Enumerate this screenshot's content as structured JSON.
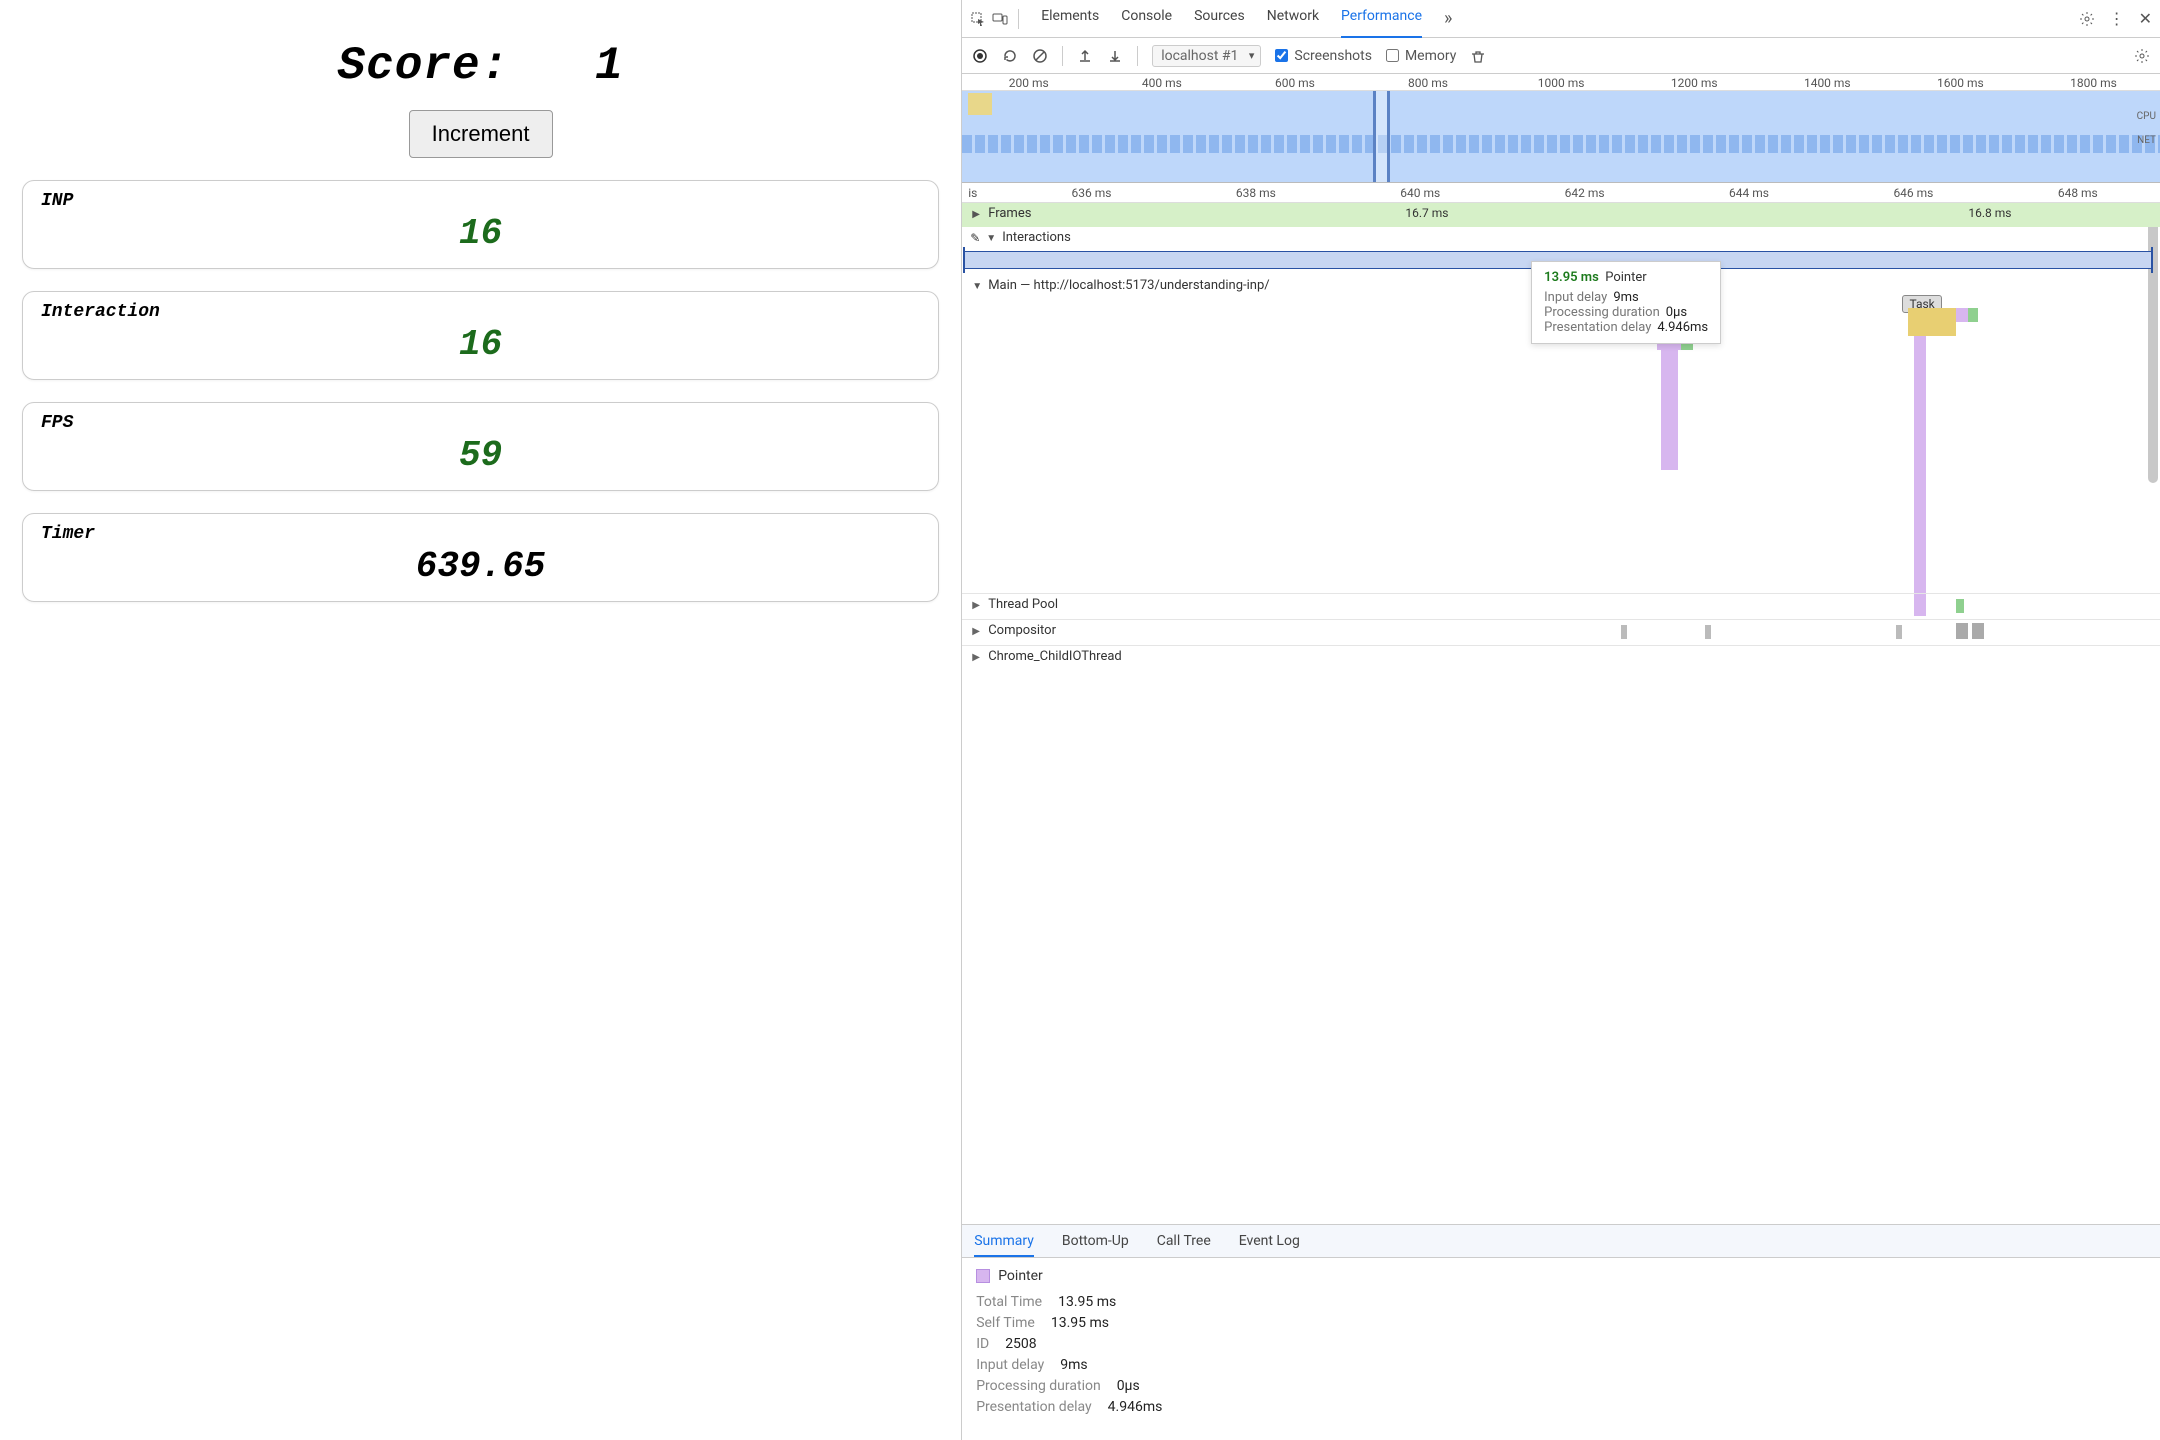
{
  "app": {
    "score_label": "Score:",
    "score_value": "1",
    "increment_label": "Increment",
    "cards": {
      "inp": {
        "label": "INP",
        "value": "16"
      },
      "interaction": {
        "label": "Interaction",
        "value": "16"
      },
      "fps": {
        "label": "FPS",
        "value": "59"
      },
      "timer": {
        "label": "Timer",
        "value": "639.65"
      }
    }
  },
  "devtools": {
    "tabs": [
      "Elements",
      "Console",
      "Sources",
      "Network",
      "Performance"
    ],
    "active_tab": "Performance",
    "more_indicator": "»",
    "controls": {
      "profile_select": "localhost #1",
      "screenshots_label": "Screenshots",
      "screenshots_checked": true,
      "memory_label": "Memory",
      "memory_checked": false
    },
    "overview_ticks": [
      "200 ms",
      "400 ms",
      "600 ms",
      "800 ms",
      "1000 ms",
      "1200 ms",
      "1400 ms",
      "1600 ms",
      "1800 ms"
    ],
    "overview_cpu": "CPU",
    "overview_net": "NET",
    "detail_ticks": [
      "636 ms",
      "638 ms",
      "640 ms",
      "642 ms",
      "644 ms",
      "646 ms",
      "648 ms"
    ],
    "lanes": {
      "frames_label": "Frames",
      "frame_times": [
        "16.7 ms",
        "16.8 ms"
      ],
      "interactions_label": "Interactions",
      "main_label": "Main — http://localhost:5173/understanding-inp/",
      "thread_pool": "Thread Pool",
      "compositor": "Compositor",
      "chrome_child": "Chrome_ChildIOThread"
    },
    "task_label": "Task",
    "tooltip": {
      "time": "13.95 ms",
      "type": "Pointer",
      "input_delay_label": "Input delay",
      "input_delay_value": "9ms",
      "processing_label": "Processing duration",
      "processing_value": "0µs",
      "presentation_label": "Presentation delay",
      "presentation_value": "4.946ms"
    },
    "bottom_tabs": [
      "Summary",
      "Bottom-Up",
      "Call Tree",
      "Event Log"
    ],
    "bottom_active": "Summary",
    "summary": {
      "pointer_label": "Pointer",
      "rows": {
        "total_time": {
          "label": "Total Time",
          "value": "13.95 ms"
        },
        "self_time": {
          "label": "Self Time",
          "value": "13.95 ms"
        },
        "id": {
          "label": "ID",
          "value": "2508"
        },
        "input_delay": {
          "label": "Input delay",
          "value": "9ms"
        },
        "processing": {
          "label": "Processing duration",
          "value": "0µs"
        },
        "presentation": {
          "label": "Presentation delay",
          "value": "4.946ms"
        }
      }
    }
  }
}
